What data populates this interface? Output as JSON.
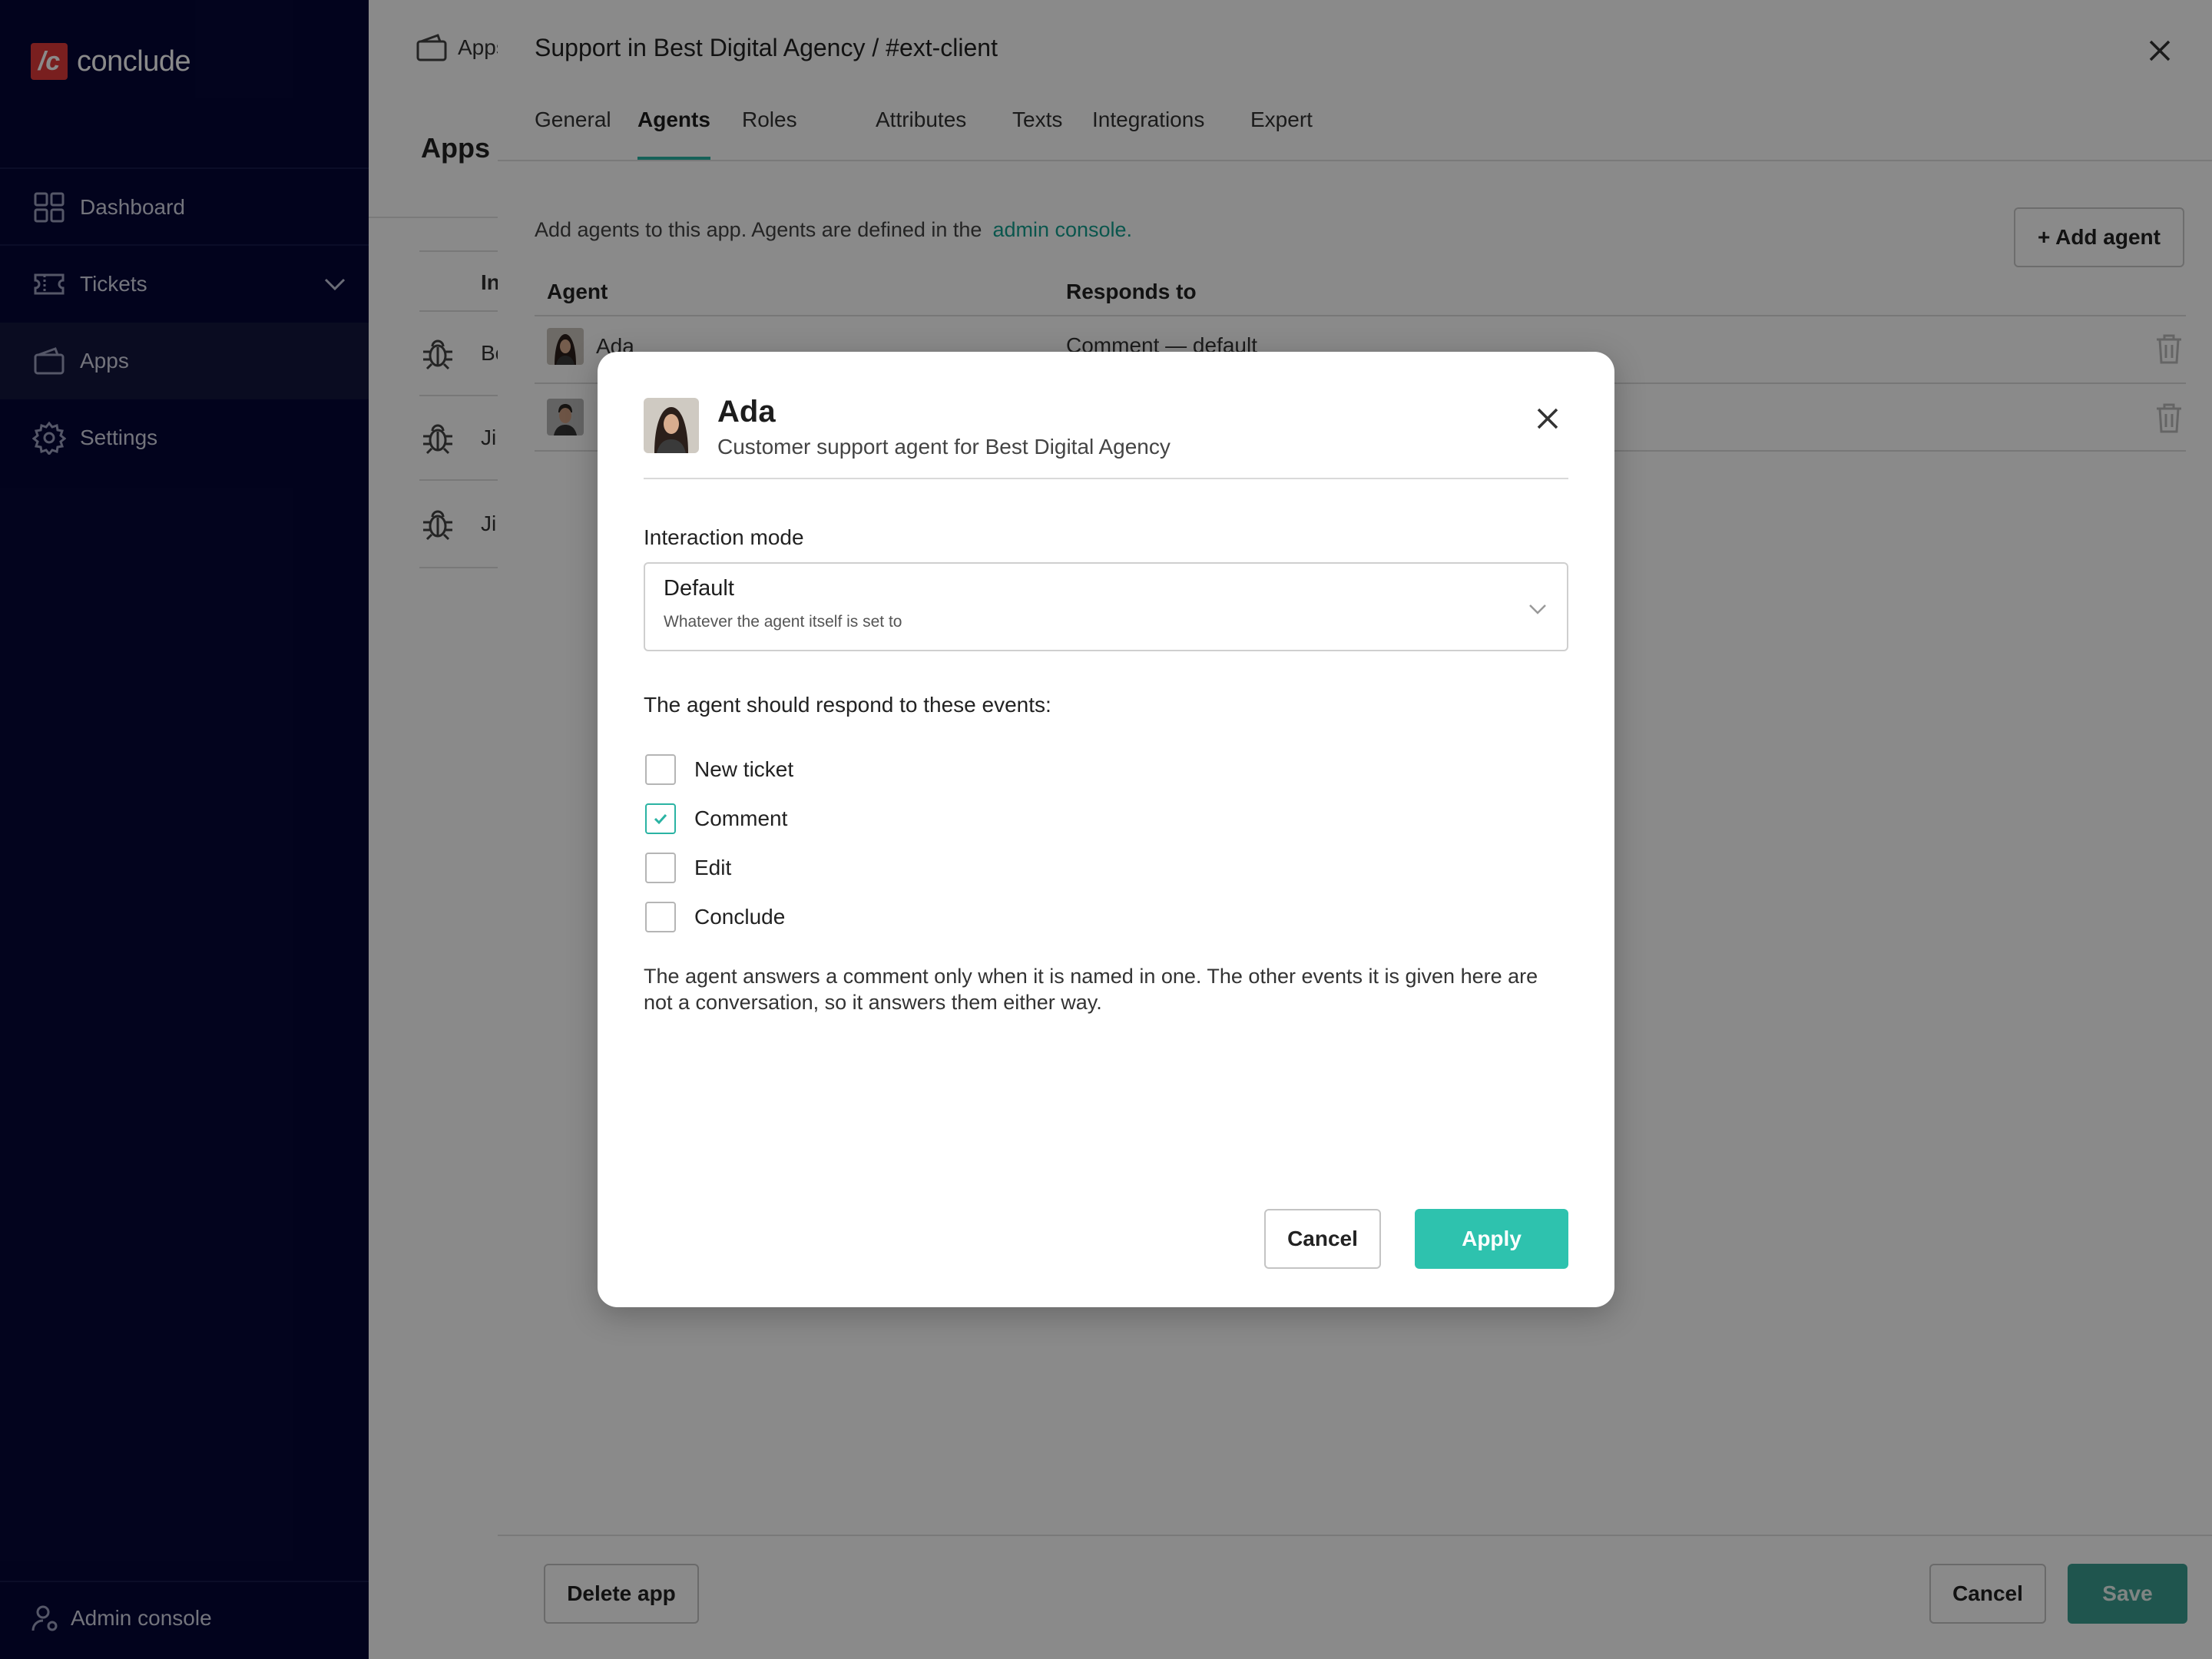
{
  "brand": {
    "mark": "/c",
    "name": "conclude",
    "accent": "#2ab3a3",
    "logo_color": "#e03a3a"
  },
  "sidebar": {
    "items": [
      {
        "label": "Dashboard",
        "icon": "grid-icon"
      },
      {
        "label": "Tickets",
        "icon": "ticket-icon"
      },
      {
        "label": "Apps",
        "icon": "wallet-icon"
      },
      {
        "label": "Settings",
        "icon": "gear-icon"
      }
    ],
    "admin_label": "Admin console"
  },
  "apps_page": {
    "crumb": "Apps",
    "title": "Apps t",
    "column": "In",
    "rows": [
      "Bo",
      "Ji",
      "Ji"
    ]
  },
  "drawer": {
    "title": "Support in Best Digital Agency / #ext-client",
    "tabs": [
      "General",
      "Agents",
      "Roles",
      "Attributes",
      "Texts",
      "Integrations",
      "Expert"
    ],
    "active_tab": "Agents",
    "intro_text": "Add agents to this app. Agents are defined in the",
    "intro_link": "admin console.",
    "add_agent_label": "+ Add agent",
    "table": {
      "headers": [
        "Agent",
        "Responds to"
      ],
      "rows": [
        {
          "name": "Ada",
          "responds": "Comment — default"
        },
        {
          "name": "",
          "responds": ""
        }
      ]
    },
    "footer": {
      "delete_label": "Delete app",
      "cancel_label": "Cancel",
      "save_label": "Save"
    }
  },
  "modal": {
    "agent_name": "Ada",
    "agent_description": "Customer support agent for Best Digital Agency",
    "interaction_label": "Interaction mode",
    "interaction_value": "Default",
    "interaction_hint": "Whatever the agent itself is set to",
    "events_label": "The agent should respond to these events:",
    "events": [
      {
        "label": "New ticket",
        "checked": false
      },
      {
        "label": "Comment",
        "checked": true
      },
      {
        "label": "Edit",
        "checked": false
      },
      {
        "label": "Conclude",
        "checked": false
      }
    ],
    "note": "The agent answers a comment only when it is named in one. The other events it is given here are not a conversation, so it answers them either way.",
    "cancel_label": "Cancel",
    "apply_label": "Apply"
  }
}
